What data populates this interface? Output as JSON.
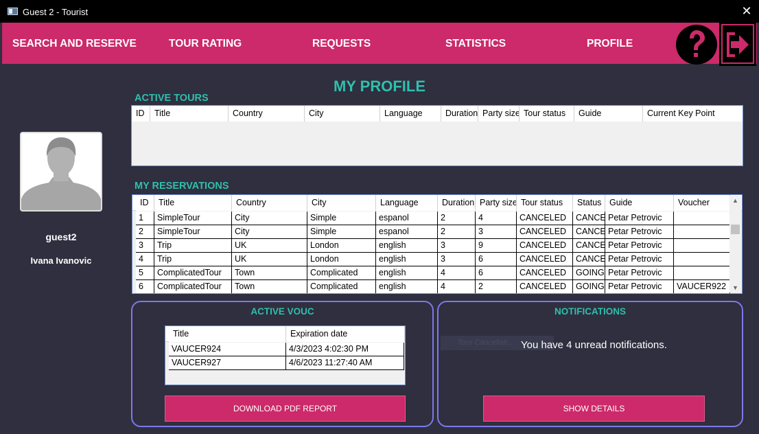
{
  "window": {
    "title": "Guest 2 - Tourist"
  },
  "nav": {
    "items": [
      {
        "label": "SEARCH AND RESERVE",
        "name": "nav-search-and-reserve"
      },
      {
        "label": "TOUR RATING",
        "name": "nav-tour-rating"
      },
      {
        "label": "REQUESTS",
        "name": "nav-requests"
      },
      {
        "label": "STATISTICS",
        "name": "nav-statistics"
      },
      {
        "label": "PROFILE",
        "name": "nav-profile"
      }
    ],
    "help_icon": "question-mark-icon",
    "logout_icon": "logout-arrow-icon"
  },
  "page": {
    "title": "MY PROFILE"
  },
  "profile": {
    "avatar_icon": "user-avatar-icon",
    "username": "guest2",
    "full_name": "Ivana Ivanovic"
  },
  "active_tours": {
    "title": "ACTIVE TOURS",
    "columns": [
      "ID",
      "Title",
      "Country",
      "City",
      "Language",
      "Duration",
      "Party size",
      "Tour status",
      "Guide",
      "Current Key Point"
    ],
    "rows": []
  },
  "reservations": {
    "title": "MY RESERVATIONS",
    "columns": [
      "ID",
      "Title",
      "Country",
      "City",
      "Language",
      "Duration",
      "Party size",
      "Tour status",
      "Status",
      "Guide",
      "Voucher"
    ],
    "rows": [
      [
        "1",
        "SimpleTour",
        "City",
        "Simple",
        "espanol",
        "2",
        "4",
        "CANCELED",
        "CANCEL",
        "Petar Petrovic",
        ""
      ],
      [
        "2",
        "SimpleTour",
        "City",
        "Simple",
        "espanol",
        "2",
        "3",
        "CANCELED",
        "CANCEL",
        "Petar Petrovic",
        ""
      ],
      [
        "3",
        "Trip",
        "UK",
        "London",
        "english",
        "3",
        "9",
        "CANCELED",
        "CANCEL",
        "Petar Petrovic",
        ""
      ],
      [
        "4",
        "Trip",
        "UK",
        "London",
        "english",
        "3",
        "6",
        "CANCELED",
        "CANCEL",
        "Petar Petrovic",
        ""
      ],
      [
        "5",
        "ComplicatedTour",
        "Town",
        "Complicated",
        "english",
        "4",
        "6",
        "CANCELED",
        "GOING",
        "Petar Petrovic",
        ""
      ],
      [
        "6",
        "ComplicatedTour",
        "Town",
        "Complicated",
        "english",
        "4",
        "2",
        "CANCELED",
        "GOING",
        "Petar Petrovic",
        "VAUCER922"
      ]
    ]
  },
  "vouchers": {
    "title": "ACTIVE VOUC",
    "columns": [
      "Title",
      "Expiration date"
    ],
    "rows": [
      [
        "VAUCER924",
        "4/3/2023 4:02:30 PM"
      ],
      [
        "VAUCER927",
        "4/6/2023 11:27:40 AM"
      ]
    ],
    "download_button": "DOWNLOAD PDF REPORT"
  },
  "notifications": {
    "title": "NOTIFICATIONS",
    "ghost_text": "Tour Cancellati...",
    "message": "You have 4 unread notifications.",
    "button": "SHOW DETAILS"
  },
  "colors": {
    "accent": "#cc2a6a",
    "teal": "#2fbfad",
    "background": "#2f2f3f",
    "panel_border": "#7d79ea"
  }
}
